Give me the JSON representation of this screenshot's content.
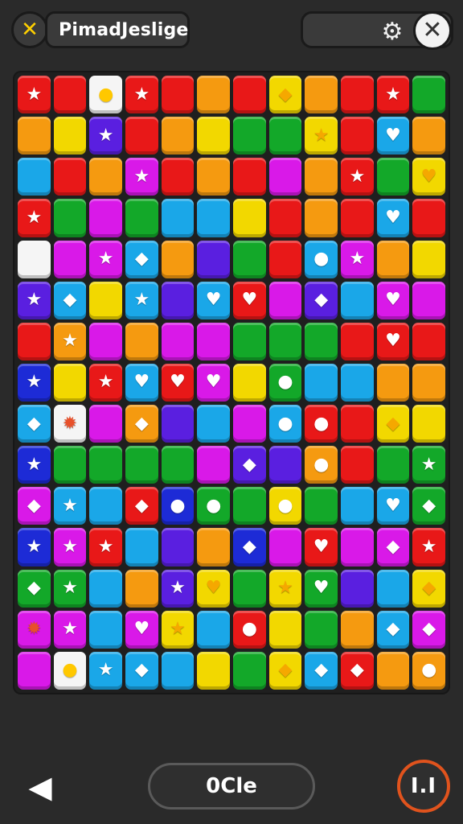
{
  "header": {
    "title": "PimadJeslige",
    "close_symbol": "✕",
    "exit_symbol": "✕",
    "settings_icon": "gear-icon"
  },
  "footer": {
    "back_icon": "back-triangle-icon",
    "center_label": "0Cle",
    "pause_label": "I.I"
  },
  "colors": {
    "R": "#e81818",
    "O": "#f59a10",
    "Y": "#f2d800",
    "G": "#13a829",
    "B": "#1aa7e8",
    "V": "#5a1fe0",
    "M": "#d919e8",
    "W": "#f5f5f5",
    "N": "#1d2bd6"
  },
  "board": {
    "rows": [
      [
        [
          "R",
          "★"
        ],
        [
          "R",
          ""
        ],
        [
          "W",
          "●"
        ],
        [
          "R",
          "★"
        ],
        [
          "R",
          ""
        ],
        [
          "O",
          ""
        ],
        [
          "R",
          ""
        ],
        [
          "Y",
          "◆"
        ],
        [
          "O",
          ""
        ],
        [
          "R",
          ""
        ],
        [
          "R",
          "★"
        ],
        [
          "G",
          ""
        ]
      ],
      [
        [
          "O",
          ""
        ],
        [
          "Y",
          ""
        ],
        [
          "V",
          "★"
        ],
        [
          "R",
          ""
        ],
        [
          "O",
          ""
        ],
        [
          "Y",
          ""
        ],
        [
          "G",
          ""
        ],
        [
          "G",
          ""
        ],
        [
          "Y",
          "★"
        ],
        [
          "R",
          ""
        ],
        [
          "B",
          "♥"
        ],
        [
          "O",
          ""
        ]
      ],
      [
        [
          "B",
          ""
        ],
        [
          "R",
          ""
        ],
        [
          "O",
          ""
        ],
        [
          "M",
          "★"
        ],
        [
          "R",
          ""
        ],
        [
          "O",
          ""
        ],
        [
          "R",
          ""
        ],
        [
          "M",
          ""
        ],
        [
          "O",
          ""
        ],
        [
          "R",
          "★"
        ],
        [
          "G",
          ""
        ],
        [
          "Y",
          "♥"
        ]
      ],
      [
        [
          "R",
          "★"
        ],
        [
          "G",
          ""
        ],
        [
          "M",
          ""
        ],
        [
          "G",
          ""
        ],
        [
          "B",
          ""
        ],
        [
          "B",
          ""
        ],
        [
          "Y",
          ""
        ],
        [
          "R",
          ""
        ],
        [
          "O",
          ""
        ],
        [
          "R",
          ""
        ],
        [
          "B",
          "♥"
        ],
        [
          "R",
          ""
        ]
      ],
      [
        [
          "W",
          ""
        ],
        [
          "M",
          ""
        ],
        [
          "M",
          "★"
        ],
        [
          "B",
          "◆"
        ],
        [
          "O",
          ""
        ],
        [
          "V",
          ""
        ],
        [
          "G",
          ""
        ],
        [
          "R",
          ""
        ],
        [
          "B",
          "●"
        ],
        [
          "M",
          "★"
        ],
        [
          "O",
          ""
        ],
        [
          "Y",
          ""
        ]
      ],
      [
        [
          "V",
          "★"
        ],
        [
          "B",
          "◆"
        ],
        [
          "Y",
          ""
        ],
        [
          "B",
          "★"
        ],
        [
          "V",
          ""
        ],
        [
          "B",
          "♥"
        ],
        [
          "R",
          "♥"
        ],
        [
          "M",
          ""
        ],
        [
          "V",
          "◆"
        ],
        [
          "B",
          ""
        ],
        [
          "M",
          "♥"
        ],
        [
          "M",
          ""
        ]
      ],
      [
        [
          "R",
          ""
        ],
        [
          "O",
          "★"
        ],
        [
          "M",
          ""
        ],
        [
          "O",
          ""
        ],
        [
          "M",
          ""
        ],
        [
          "M",
          ""
        ],
        [
          "G",
          ""
        ],
        [
          "G",
          ""
        ],
        [
          "G",
          ""
        ],
        [
          "R",
          ""
        ],
        [
          "R",
          "♥"
        ],
        [
          "R",
          ""
        ]
      ],
      [
        [
          "N",
          "★"
        ],
        [
          "Y",
          ""
        ],
        [
          "R",
          "★"
        ],
        [
          "B",
          "♥"
        ],
        [
          "R",
          "♥"
        ],
        [
          "M",
          "♥"
        ],
        [
          "Y",
          ""
        ],
        [
          "G",
          "●"
        ],
        [
          "B",
          ""
        ],
        [
          "B",
          ""
        ],
        [
          "O",
          ""
        ],
        [
          "O",
          ""
        ]
      ],
      [
        [
          "B",
          "◆"
        ],
        [
          "W",
          "✹"
        ],
        [
          "M",
          ""
        ],
        [
          "O",
          "◆"
        ],
        [
          "V",
          ""
        ],
        [
          "B",
          ""
        ],
        [
          "M",
          ""
        ],
        [
          "B",
          "●"
        ],
        [
          "R",
          "●"
        ],
        [
          "R",
          ""
        ],
        [
          "Y",
          "◆"
        ],
        [
          "Y",
          ""
        ]
      ],
      [
        [
          "N",
          "★"
        ],
        [
          "G",
          ""
        ],
        [
          "G",
          ""
        ],
        [
          "G",
          ""
        ],
        [
          "G",
          ""
        ],
        [
          "M",
          ""
        ],
        [
          "V",
          "◆"
        ],
        [
          "V",
          ""
        ],
        [
          "O",
          "●"
        ],
        [
          "R",
          ""
        ],
        [
          "G",
          ""
        ],
        [
          "G",
          "★"
        ]
      ],
      [
        [
          "M",
          "◆"
        ],
        [
          "B",
          "★"
        ],
        [
          "B",
          ""
        ],
        [
          "R",
          "◆"
        ],
        [
          "N",
          "●"
        ],
        [
          "G",
          "●"
        ],
        [
          "G",
          ""
        ],
        [
          "Y",
          "●"
        ],
        [
          "G",
          ""
        ],
        [
          "B",
          ""
        ],
        [
          "B",
          "♥"
        ],
        [
          "G",
          "◆"
        ]
      ],
      [
        [
          "N",
          "★"
        ],
        [
          "M",
          "★"
        ],
        [
          "R",
          "★"
        ],
        [
          "B",
          ""
        ],
        [
          "V",
          ""
        ],
        [
          "O",
          ""
        ],
        [
          "N",
          "◆"
        ],
        [
          "M",
          ""
        ],
        [
          "R",
          "♥"
        ],
        [
          "M",
          ""
        ],
        [
          "M",
          "◆"
        ],
        [
          "R",
          "★"
        ]
      ],
      [
        [
          "G",
          "◆"
        ],
        [
          "G",
          "★"
        ],
        [
          "B",
          ""
        ],
        [
          "O",
          ""
        ],
        [
          "V",
          "★"
        ],
        [
          "Y",
          "♥"
        ],
        [
          "G",
          ""
        ],
        [
          "Y",
          "★"
        ],
        [
          "G",
          "♥"
        ],
        [
          "V",
          ""
        ],
        [
          "B",
          ""
        ],
        [
          "Y",
          "◆"
        ]
      ],
      [
        [
          "M",
          "✹"
        ],
        [
          "M",
          "★"
        ],
        [
          "B",
          ""
        ],
        [
          "M",
          "♥"
        ],
        [
          "Y",
          "★"
        ],
        [
          "B",
          ""
        ],
        [
          "R",
          "●"
        ],
        [
          "Y",
          ""
        ],
        [
          "G",
          ""
        ],
        [
          "O",
          ""
        ],
        [
          "B",
          "◆"
        ],
        [
          "M",
          "◆"
        ]
      ],
      [
        [
          "M",
          ""
        ],
        [
          "W",
          "●"
        ],
        [
          "B",
          "★"
        ],
        [
          "B",
          "◆"
        ],
        [
          "B",
          ""
        ],
        [
          "Y",
          ""
        ],
        [
          "G",
          ""
        ],
        [
          "Y",
          "◆"
        ],
        [
          "B",
          "◆"
        ],
        [
          "R",
          "◆"
        ],
        [
          "O",
          ""
        ],
        [
          "O",
          "●"
        ]
      ]
    ]
  }
}
